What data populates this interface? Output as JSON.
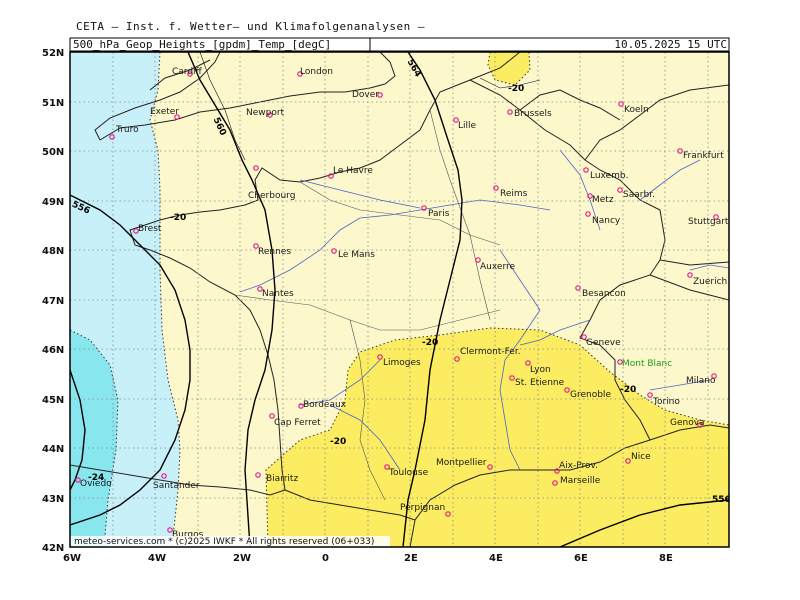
{
  "header": {
    "title": "CETA – Inst. f. Wetter– und Klimafolgenanalysen –",
    "subtitle_left": "500_hPa_Geop_Heights_[gpdm]_Temp_[degC]",
    "subtitle_right": "10.05.2025 15 UTC"
  },
  "footer": "meteo-services.com * (c)2025 IWKF * All rights reserved (06+033)",
  "colors": {
    "sea": "#c8f0f8",
    "land_cold": "#fdf7cc",
    "land_warm": "#fbec62",
    "cold_pool": "#88e6ee",
    "grid": "#888888",
    "city_marker": "#e0208a",
    "river": "#4a66c8",
    "border": "#222222"
  },
  "axes": {
    "lat_labels": [
      "52N",
      "51N",
      "50N",
      "49N",
      "48N",
      "47N",
      "46N",
      "45N",
      "44N",
      "43N",
      "42N"
    ],
    "lon_labels": [
      "6W",
      "4W",
      "2W",
      "0",
      "2E",
      "4E",
      "6E",
      "8E"
    ]
  },
  "contour_labels": {
    "geopotential": [
      "564",
      "560",
      "556",
      "556",
      "560"
    ],
    "temperature": [
      "-20",
      "-20",
      "-20",
      "-20",
      "-20",
      "-24",
      "-20"
    ]
  },
  "cities": [
    {
      "name": "Cardiff"
    },
    {
      "name": "London"
    },
    {
      "name": "Dover"
    },
    {
      "name": "Exeter"
    },
    {
      "name": "Truro"
    },
    {
      "name": "Newport"
    },
    {
      "name": "Cherbourg"
    },
    {
      "name": "Le Havre"
    },
    {
      "name": "Lille"
    },
    {
      "name": "Brussels"
    },
    {
      "name": "Koeln"
    },
    {
      "name": "Frankfurt"
    },
    {
      "name": "Luxemb."
    },
    {
      "name": "Reims"
    },
    {
      "name": "Metz"
    },
    {
      "name": "Saarbr."
    },
    {
      "name": "Nancy"
    },
    {
      "name": "Stuttgart"
    },
    {
      "name": "Paris"
    },
    {
      "name": "Brest"
    },
    {
      "name": "Rennes"
    },
    {
      "name": "Le Mans"
    },
    {
      "name": "Auxerre"
    },
    {
      "name": "Zuerich"
    },
    {
      "name": "Nantes"
    },
    {
      "name": "Besancon"
    },
    {
      "name": "Geneve"
    },
    {
      "name": "Limoges"
    },
    {
      "name": "Clermont-Fer."
    },
    {
      "name": "Lyon"
    },
    {
      "name": "Mont Blanc"
    },
    {
      "name": "St. Etienne"
    },
    {
      "name": "Grenoble"
    },
    {
      "name": "Milano"
    },
    {
      "name": "Bordeaux"
    },
    {
      "name": "Torino"
    },
    {
      "name": "Cap Ferret"
    },
    {
      "name": "Genova"
    },
    {
      "name": "Nice"
    },
    {
      "name": "Montpellier"
    },
    {
      "name": "Toulouse"
    },
    {
      "name": "Aix-Prov."
    },
    {
      "name": "Oviedo"
    },
    {
      "name": "Santander"
    },
    {
      "name": "Biarritz"
    },
    {
      "name": "Marseille"
    },
    {
      "name": "Perpignan"
    },
    {
      "name": "Burgos"
    }
  ]
}
